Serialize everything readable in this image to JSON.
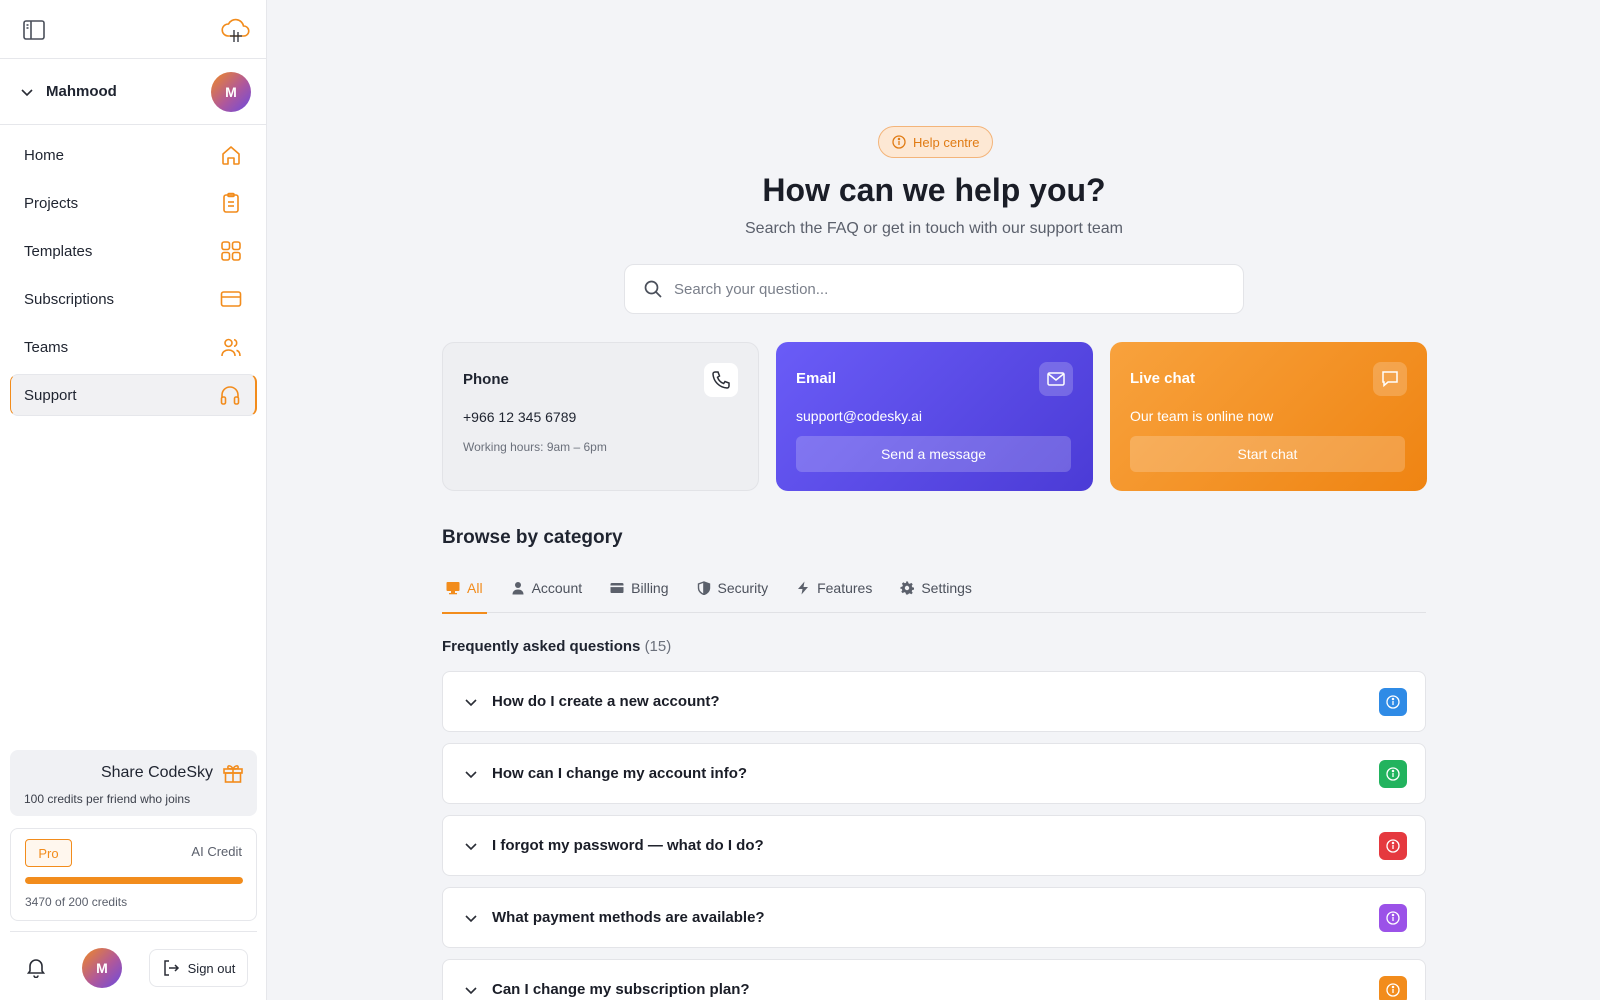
{
  "sidebar": {
    "user_name": "Mahmood",
    "avatar_initial": "M",
    "nav": [
      {
        "label": "Home",
        "icon": "home-icon"
      },
      {
        "label": "Projects",
        "icon": "clipboard-icon"
      },
      {
        "label": "Templates",
        "icon": "grid-icon"
      },
      {
        "label": "Subscriptions",
        "icon": "credit-card-icon"
      },
      {
        "label": "Teams",
        "icon": "users-icon"
      },
      {
        "label": "Support",
        "icon": "headphones-icon",
        "active": true
      }
    ],
    "share": {
      "title": "Share CodeSky",
      "subtitle": "100 credits per friend who joins"
    },
    "credits": {
      "plan": "Pro",
      "label": "AI Credit",
      "text": "3470 of 200 credits",
      "progress_fraction": 1.0
    },
    "sign_out": "Sign out"
  },
  "main": {
    "badge": "Help centre",
    "title": "How can we help you?",
    "subtitle": "Search the FAQ or get in touch with our support team",
    "search_placeholder": "Search your question...",
    "cards": {
      "phone": {
        "title": "Phone",
        "value": "+966 12 345 6789",
        "note": "Working hours: 9am – 6pm"
      },
      "email": {
        "title": "Email",
        "value": "support@codesky.ai",
        "button": "Send a message"
      },
      "chat": {
        "title": "Live chat",
        "value": "Our team is online now",
        "button": "Start chat"
      }
    },
    "browse_title": "Browse by category",
    "tabs": [
      {
        "label": "All",
        "icon": "monitor-icon",
        "active": true
      },
      {
        "label": "Account",
        "icon": "user-icon"
      },
      {
        "label": "Billing",
        "icon": "card-icon"
      },
      {
        "label": "Security",
        "icon": "shield-icon"
      },
      {
        "label": "Features",
        "icon": "bolt-icon"
      },
      {
        "label": "Settings",
        "icon": "gear-icon"
      }
    ],
    "faq_title": "Frequently asked questions",
    "faq_count": "(15)",
    "faqs": [
      {
        "q": "How do I create a new account?",
        "color": "#2f8be6"
      },
      {
        "q": "How can I change my account info?",
        "color": "#22b35e"
      },
      {
        "q": "I forgot my password — what do I do?",
        "color": "#e5393f"
      },
      {
        "q": "What payment methods are available?",
        "color": "#9b52e8"
      },
      {
        "q": "Can I change my subscription plan?",
        "color": "#f28c1c"
      }
    ]
  },
  "colors": {
    "accent": "#f28c1c",
    "email_card": "#5a4bec",
    "background": "#f3f4f7"
  }
}
